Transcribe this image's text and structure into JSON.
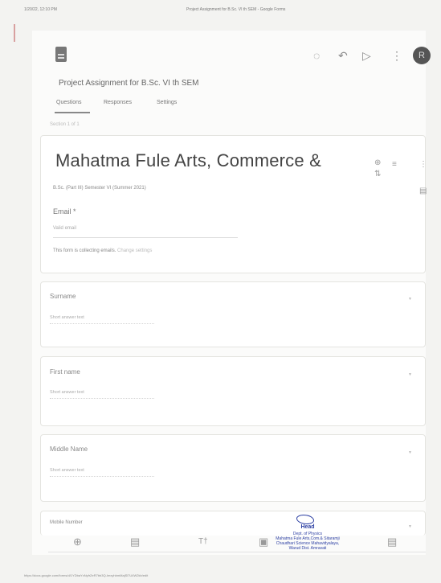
{
  "browser": {
    "date_time": "1/20/22, 12:10 PM",
    "page_title": "Project Assignment for B.Sc. VI th SEM - Google Forms",
    "footer_url": "https://docs.google.com/forms/d/1YDbaYxNyfrZeR7bb3Q-ImxyhbmMajSl7U4W2kb/edit"
  },
  "header": {
    "form_title": "Project Assignment for B.Sc. VI th SEM",
    "avatar_initial": "R",
    "icons": [
      "palette-icon",
      "undo-icon",
      "send-icon",
      "more-vert-icon"
    ]
  },
  "tabs": [
    "Questions",
    "Responses",
    "Settings"
  ],
  "section_label": "Section 1 of 1",
  "title_card": {
    "title": "Mahatma Fule Arts, Commerce &",
    "description": "B.Sc. (Part III) Semester VI (Summer 2021)",
    "email_label": "Email *",
    "email_placeholder": "Valid email",
    "collecting_text": "This form is collecting emails.",
    "change_settings": "Change settings"
  },
  "questions": [
    {
      "label": "Surname",
      "placeholder": "Short answer text"
    },
    {
      "label": "First name",
      "placeholder": "Short answer text"
    },
    {
      "label": "Middle Name",
      "placeholder": "Short answer text"
    },
    {
      "label": "Mobile Number",
      "placeholder": ""
    }
  ],
  "stamp": {
    "title": "Head",
    "line1": "Dept. of Physics",
    "line2": "Mahatma Fule Arts,Com.& Sitaramji",
    "line3": "Chaudhari Science Mahavidyalaya,",
    "line4": "Warud Dist. Amravati"
  }
}
